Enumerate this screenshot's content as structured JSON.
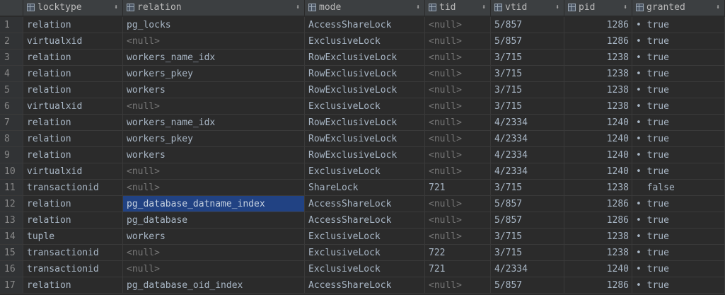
{
  "columns": [
    {
      "key": "locktype",
      "label": "locktype"
    },
    {
      "key": "relation",
      "label": "relation"
    },
    {
      "key": "mode",
      "label": "mode"
    },
    {
      "key": "tid",
      "label": "tid"
    },
    {
      "key": "vtid",
      "label": "vtid"
    },
    {
      "key": "pid",
      "label": "pid"
    },
    {
      "key": "granted",
      "label": "granted"
    }
  ],
  "sort_glyph": "⬍",
  "null_text": "<null>",
  "selected": {
    "row": 11,
    "col": "relation"
  },
  "rows": [
    {
      "n": "1",
      "locktype": "relation",
      "relation": "pg_locks",
      "mode": "AccessShareLock",
      "tid": "<null>",
      "vtid": "5/857",
      "pid": "1286",
      "granted": "true"
    },
    {
      "n": "2",
      "locktype": "virtualxid",
      "relation": "<null>",
      "mode": "ExclusiveLock",
      "tid": "<null>",
      "vtid": "5/857",
      "pid": "1286",
      "granted": "true"
    },
    {
      "n": "3",
      "locktype": "relation",
      "relation": "workers_name_idx",
      "mode": "RowExclusiveLock",
      "tid": "<null>",
      "vtid": "3/715",
      "pid": "1238",
      "granted": "true"
    },
    {
      "n": "4",
      "locktype": "relation",
      "relation": "workers_pkey",
      "mode": "RowExclusiveLock",
      "tid": "<null>",
      "vtid": "3/715",
      "pid": "1238",
      "granted": "true"
    },
    {
      "n": "5",
      "locktype": "relation",
      "relation": "workers",
      "mode": "RowExclusiveLock",
      "tid": "<null>",
      "vtid": "3/715",
      "pid": "1238",
      "granted": "true"
    },
    {
      "n": "6",
      "locktype": "virtualxid",
      "relation": "<null>",
      "mode": "ExclusiveLock",
      "tid": "<null>",
      "vtid": "3/715",
      "pid": "1238",
      "granted": "true"
    },
    {
      "n": "7",
      "locktype": "relation",
      "relation": "workers_name_idx",
      "mode": "RowExclusiveLock",
      "tid": "<null>",
      "vtid": "4/2334",
      "pid": "1240",
      "granted": "true"
    },
    {
      "n": "8",
      "locktype": "relation",
      "relation": "workers_pkey",
      "mode": "RowExclusiveLock",
      "tid": "<null>",
      "vtid": "4/2334",
      "pid": "1240",
      "granted": "true"
    },
    {
      "n": "9",
      "locktype": "relation",
      "relation": "workers",
      "mode": "RowExclusiveLock",
      "tid": "<null>",
      "vtid": "4/2334",
      "pid": "1240",
      "granted": "true"
    },
    {
      "n": "10",
      "locktype": "virtualxid",
      "relation": "<null>",
      "mode": "ExclusiveLock",
      "tid": "<null>",
      "vtid": "4/2334",
      "pid": "1240",
      "granted": "true"
    },
    {
      "n": "11",
      "locktype": "transactionid",
      "relation": "<null>",
      "mode": "ShareLock",
      "tid": "721",
      "vtid": "3/715",
      "pid": "1238",
      "granted": "false"
    },
    {
      "n": "12",
      "locktype": "relation",
      "relation": "pg_database_datname_index",
      "mode": "AccessShareLock",
      "tid": "<null>",
      "vtid": "5/857",
      "pid": "1286",
      "granted": "true"
    },
    {
      "n": "13",
      "locktype": "relation",
      "relation": "pg_database",
      "mode": "AccessShareLock",
      "tid": "<null>",
      "vtid": "5/857",
      "pid": "1286",
      "granted": "true"
    },
    {
      "n": "14",
      "locktype": "tuple",
      "relation": "workers",
      "mode": "ExclusiveLock",
      "tid": "<null>",
      "vtid": "3/715",
      "pid": "1238",
      "granted": "true"
    },
    {
      "n": "15",
      "locktype": "transactionid",
      "relation": "<null>",
      "mode": "ExclusiveLock",
      "tid": "722",
      "vtid": "3/715",
      "pid": "1238",
      "granted": "true"
    },
    {
      "n": "16",
      "locktype": "transactionid",
      "relation": "<null>",
      "mode": "ExclusiveLock",
      "tid": "721",
      "vtid": "4/2334",
      "pid": "1240",
      "granted": "true"
    },
    {
      "n": "17",
      "locktype": "relation",
      "relation": "pg_database_oid_index",
      "mode": "AccessShareLock",
      "tid": "<null>",
      "vtid": "5/857",
      "pid": "1286",
      "granted": "true"
    }
  ]
}
